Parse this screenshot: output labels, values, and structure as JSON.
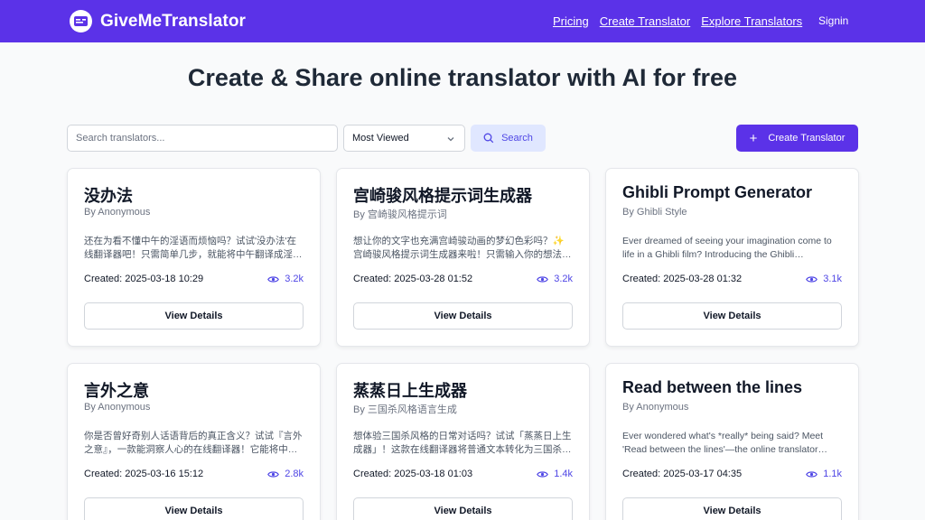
{
  "nav": {
    "brand": "GiveMeTranslator",
    "links": [
      "Pricing",
      "Create Translator",
      "Explore Translators"
    ],
    "signin": "Signin"
  },
  "hero": {
    "title": "Create & Share online translator with AI for free"
  },
  "toolbar": {
    "search_placeholder": "Search translators...",
    "sort_selected": "Most Viewed",
    "search_label": "Search",
    "create_label": "Create Translator"
  },
  "view_details_label": "View Details",
  "cards": [
    {
      "title": "没办法",
      "author": "By Anonymous",
      "desc": "还在为看不懂中午的淫语而烦恼吗？试试'没办法'在线翻译器吧！只需简单几步，就能将中午翻译成淫…",
      "created": "Created: 2025-03-18 10:29",
      "views": "3.2k"
    },
    {
      "title": "宫崎骏风格提示词生成器",
      "author": "By 宫崎骏风格提示词",
      "desc": "想让你的文字也充满宫崎骏动画的梦幻色彩吗？✨宫崎骏风格提示词生成器来啦！只需输入你的想法…",
      "created": "Created: 2025-03-28 01:52",
      "views": "3.2k"
    },
    {
      "title": "Ghibli Prompt Generator",
      "author": "By Ghibli Style",
      "desc": "Ever dreamed of seeing your imagination come to life in a Ghibli film? Introducing the Ghibli…",
      "created": "Created: 2025-03-28 01:32",
      "views": "3.1k"
    },
    {
      "title": "言外之意",
      "author": "By Anonymous",
      "desc": "你是否曾好奇别人话语背后的真正含义？试试『言外之意』，一款能洞察人心的在线翻译器！它能将中…",
      "created": "Created: 2025-03-16 15:12",
      "views": "2.8k"
    },
    {
      "title": "蒸蒸日上生成器",
      "author": "By 三国杀风格语言生成",
      "desc": "想体验三国杀风格的日常对话吗？试试「蒸蒸日上生成器」！这款在线翻译器将普通文本转化为三国杀…",
      "created": "Created: 2025-03-18 01:03",
      "views": "1.4k"
    },
    {
      "title": "Read between the lines",
      "author": "By Anonymous",
      "desc": "Ever wondered what's *really* being said? Meet 'Read between the lines'—the online translator…",
      "created": "Created: 2025-03-17 04:35",
      "views": "1.1k"
    }
  ],
  "colors": {
    "brand": "#5b32e8",
    "accent": "#4f46e5",
    "search_bg": "#e0e7ff",
    "page_bg": "#f9fafb"
  }
}
